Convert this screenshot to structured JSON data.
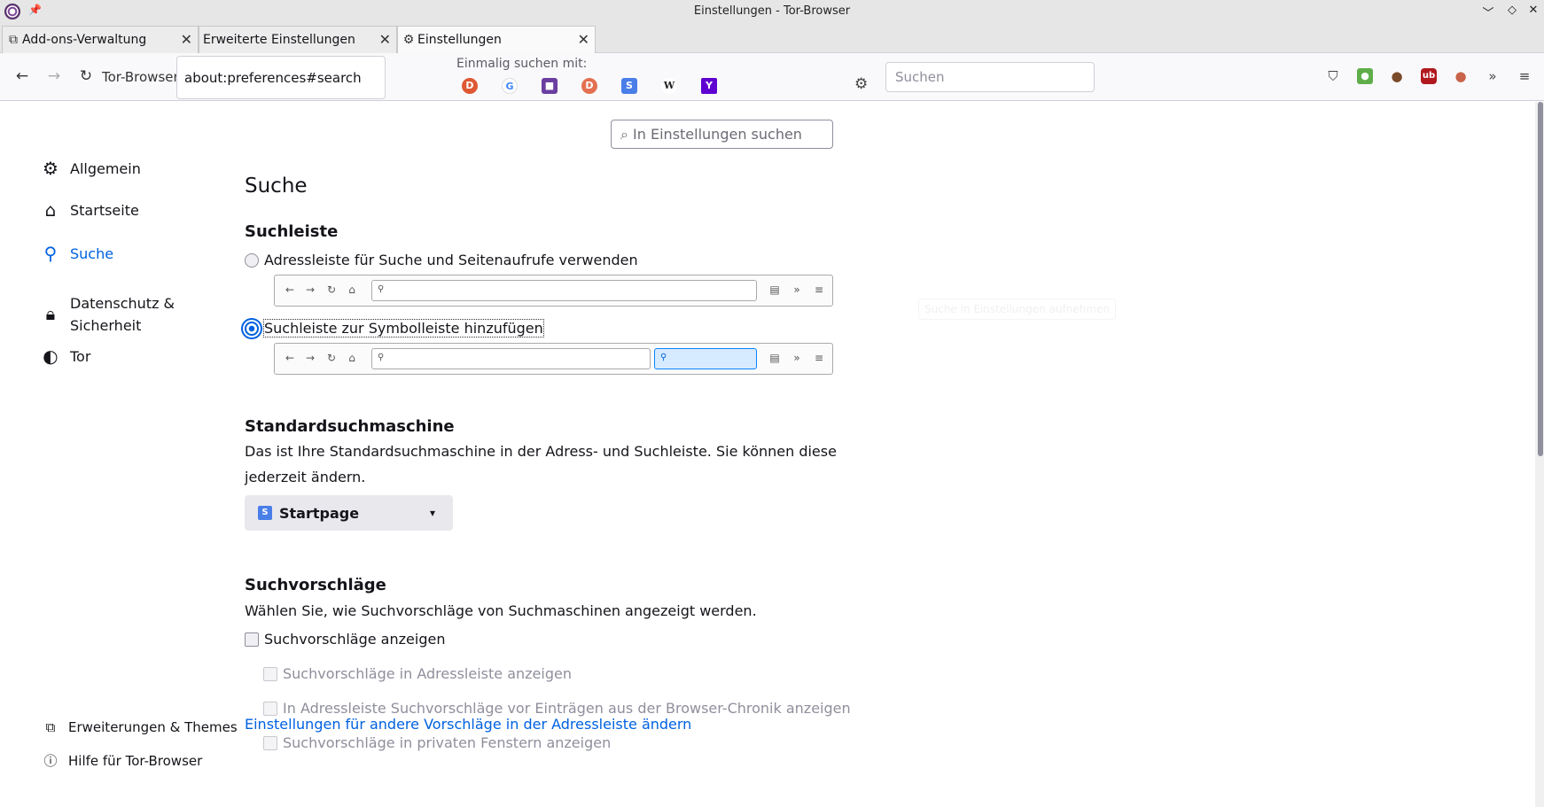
{
  "window": {
    "title": "Einstellungen - Tor-Browser",
    "controls": [
      "﹀",
      "◇",
      "✕"
    ]
  },
  "tabs": [
    {
      "label": "Add-ons-Verwaltung",
      "icon": "puzzle-icon"
    },
    {
      "label": "Erweiterte Einstellungen",
      "icon": ""
    },
    {
      "label": "Einstellungen",
      "icon": "gear-icon"
    }
  ],
  "navbar": {
    "identity_label": "Tor-Browser",
    "url": "about:preferences#search",
    "oneoff_label": "Einmalig suchen mit:",
    "oneoff_engines": [
      {
        "name": "DuckDuckGo",
        "glyph": "D",
        "color": "#de5833"
      },
      {
        "name": "Google",
        "glyph": "G",
        "color": "#4285f4"
      },
      {
        "name": "Blockchair",
        "glyph": "■",
        "color": "#6b3fa0"
      },
      {
        "name": "DuckDuckGo Onion",
        "glyph": "D",
        "color": "#e37151"
      },
      {
        "name": "Startpage",
        "glyph": "S",
        "color": "#4a7ee8"
      },
      {
        "name": "Wikipedia",
        "glyph": "W",
        "color": "#222222"
      },
      {
        "name": "Yahoo",
        "glyph": "Y",
        "color": "#5f01d1"
      }
    ],
    "search_placeholder": "Suchen"
  },
  "content": {
    "find_placeholder": "In Einstellungen suchen",
    "sidebar": {
      "items": [
        {
          "label": "Allgemein",
          "icon": "gear-icon"
        },
        {
          "label": "Startseite",
          "icon": "home-icon"
        },
        {
          "label": "Suche",
          "icon": "search-icon"
        },
        {
          "label": "Datenschutz &",
          "label2": "Sicherheit",
          "icon": "lock-icon"
        },
        {
          "label": "Tor",
          "icon": "tor-onion-icon"
        }
      ],
      "bottom": [
        {
          "label": "Erweiterungen & Themes",
          "icon": "puzzle-icon"
        },
        {
          "label": "Hilfe für Tor-Browser",
          "icon": "help-icon"
        }
      ]
    },
    "page_title": "Suche",
    "searchbar_section": {
      "heading": "Suchleiste",
      "option1": "Adressleiste für Suche und Seitenaufrufe verwenden",
      "option2": "Suchleiste zur Symbolleiste hinzufügen"
    },
    "ghost_text": "Suche in Einstellungen aufnehmen",
    "default_engine": {
      "heading": "Standardsuchmaschine",
      "description": "Das ist Ihre Standardsuchmaschine in der Adress- und Suchleiste. Sie können diese jederzeit ändern.",
      "selected": "Startpage"
    },
    "suggestions": {
      "heading": "Suchvorschläge",
      "description": "Wählen Sie, wie Suchvorschläge von Suchmaschinen angezeigt werden.",
      "show": "Suchvorschläge anzeigen",
      "in_urlbar": "Suchvorschläge in Adressleiste anzeigen",
      "before_history": "In Adressleiste Suchvorschläge vor Einträgen aus der Browser-Chronik anzeigen",
      "private": "Suchvorschläge in privaten Fenstern anzeigen",
      "link": "Einstellungen für andere Vorschläge in der Adressleiste ändern"
    }
  }
}
